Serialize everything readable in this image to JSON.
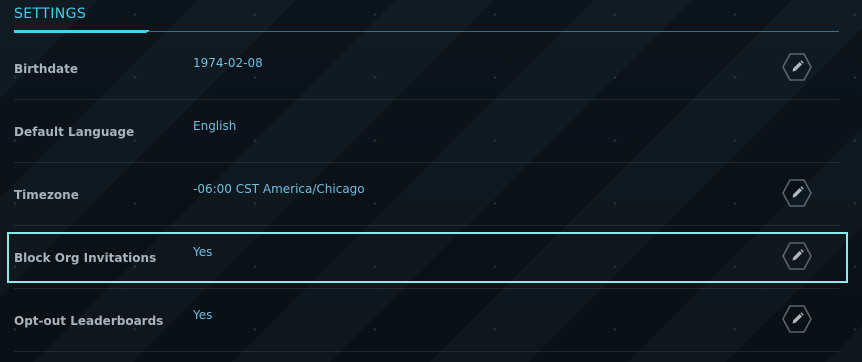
{
  "settings": {
    "title": "SETTINGS",
    "rows": [
      {
        "label": "Birthdate",
        "value": "1974-02-08",
        "editable": true
      },
      {
        "label": "Default Language",
        "value": "English",
        "editable": false
      },
      {
        "label": "Timezone",
        "value": "-06:00 CST America/Chicago",
        "editable": true
      },
      {
        "label": "Block Org Invitations",
        "value": "Yes",
        "editable": true
      },
      {
        "label": "Opt-out Leaderboards",
        "value": "Yes",
        "editable": true
      }
    ],
    "edit_icon": "pencil-hexagon-icon",
    "colors": {
      "accent": "#40d4f2",
      "value_text": "#74bde0",
      "label_text": "#a9b3bb",
      "highlight": "#8fe7ee"
    }
  }
}
